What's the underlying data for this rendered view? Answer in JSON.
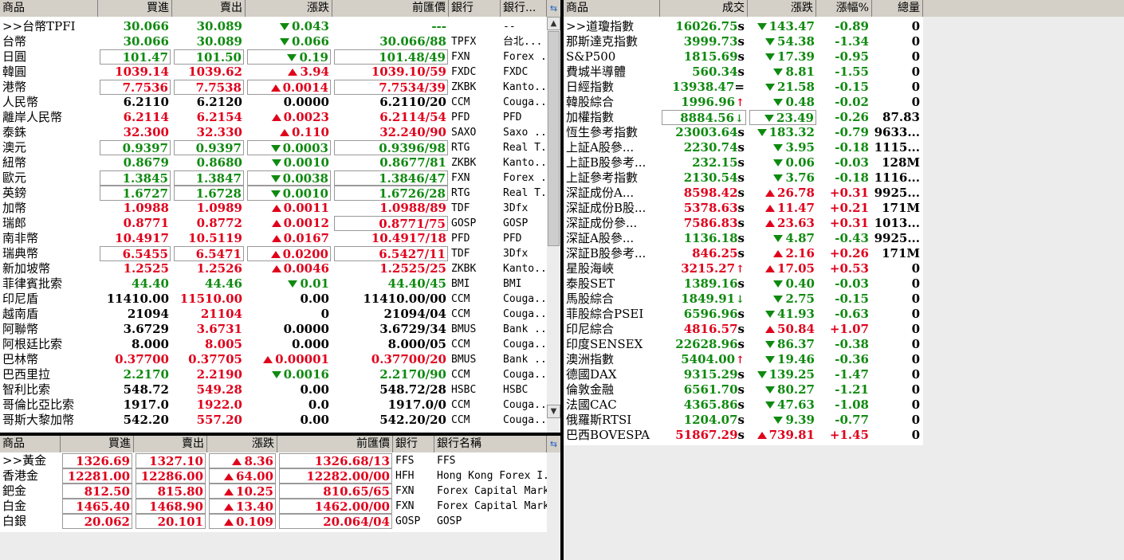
{
  "fx": {
    "headers": [
      "商品",
      "買進",
      "賣出",
      "漲跌",
      "前匯價",
      "銀行",
      "銀行..."
    ],
    "corner_icon": "refresh-icon",
    "rows": [
      {
        "name": ">>台幣TPFI",
        "bid": "30.066",
        "ask": "30.089",
        "chg": "0.043",
        "dir": "dn",
        "prev": "---",
        "bank": "",
        "bankname": "--"
      },
      {
        "name": "台幣",
        "bid": "30.066",
        "ask": "30.089",
        "chg": "0.066",
        "dir": "dn",
        "prev": "30.066/88",
        "bank": "TPFX",
        "bankname": "台北..."
      },
      {
        "name": "日圓",
        "bid": "101.47",
        "ask": "101.50",
        "chg": "0.19",
        "dir": "dn",
        "prev": "101.48/49",
        "bank": "FXN",
        "bankname": "Forex ...",
        "boxed": true
      },
      {
        "name": "韓圓",
        "bid": "1039.14",
        "ask": "1039.62",
        "chg": "3.94",
        "dir": "up",
        "prev": "1039.10/59",
        "bank": "FXDC",
        "bankname": "FXDC"
      },
      {
        "name": "港幣",
        "bid": "7.7536",
        "ask": "7.7538",
        "chg": "0.0014",
        "dir": "up",
        "prev": "7.7534/39",
        "bank": "ZKBK",
        "bankname": "Kanto...",
        "boxed": true
      },
      {
        "name": "人民幣",
        "bid": "6.2110",
        "ask": "6.2120",
        "chg": "0.0000",
        "dir": "fl",
        "prev": "6.2110/20",
        "bank": "CCM",
        "bankname": "Couga..."
      },
      {
        "name": "離岸人民幣",
        "bid": "6.2114",
        "ask": "6.2154",
        "chg": "0.0023",
        "dir": "up",
        "prev": "6.2114/54",
        "bank": "PFD",
        "bankname": "PFD"
      },
      {
        "name": "泰銖",
        "bid": "32.300",
        "ask": "32.330",
        "chg": "0.110",
        "dir": "up",
        "prev": "32.240/90",
        "bank": "SAXO",
        "bankname": "Saxo ..."
      },
      {
        "name": "澳元",
        "bid": "0.9397",
        "ask": "0.9397",
        "chg": "0.0003",
        "dir": "dn",
        "prev": "0.9396/98",
        "bank": "RTG",
        "bankname": "Real T...",
        "boxed": true
      },
      {
        "name": "紐幣",
        "bid": "0.8679",
        "ask": "0.8680",
        "chg": "0.0010",
        "dir": "dn",
        "prev": "0.8677/81",
        "bank": "ZKBK",
        "bankname": "Kanto..."
      },
      {
        "name": "歐元",
        "bid": "1.3845",
        "ask": "1.3847",
        "chg": "0.0038",
        "dir": "dn",
        "prev": "1.3846/47",
        "bank": "FXN",
        "bankname": "Forex ...",
        "boxed": true
      },
      {
        "name": "英鎊",
        "bid": "1.6727",
        "ask": "1.6728",
        "chg": "0.0010",
        "dir": "dn",
        "prev": "1.6726/28",
        "bank": "RTG",
        "bankname": "Real T...",
        "boxed": true
      },
      {
        "name": "加幣",
        "bid": "1.0988",
        "ask": "1.0989",
        "chg": "0.0011",
        "dir": "up",
        "prev": "1.0988/89",
        "bank": "TDF",
        "bankname": "3Dfx"
      },
      {
        "name": "瑞郎",
        "bid": "0.8771",
        "ask": "0.8772",
        "chg": "0.0012",
        "dir": "up",
        "prev": "0.8771/75",
        "bank": "GOSP",
        "bankname": "GOSP",
        "boxprev": true
      },
      {
        "name": "南非幣",
        "bid": "10.4917",
        "ask": "10.5119",
        "chg": "0.0167",
        "dir": "up",
        "prev": "10.4917/18",
        "bank": "PFD",
        "bankname": "PFD"
      },
      {
        "name": "瑞典幣",
        "bid": "6.5455",
        "ask": "6.5471",
        "chg": "0.0200",
        "dir": "up",
        "prev": "6.5427/11",
        "bank": "TDF",
        "bankname": "3Dfx",
        "boxed": true
      },
      {
        "name": "新加坡幣",
        "bid": "1.2525",
        "ask": "1.2526",
        "chg": "0.0046",
        "dir": "up",
        "prev": "1.2525/25",
        "bank": "ZKBK",
        "bankname": "Kanto..."
      },
      {
        "name": "菲律賓批索",
        "bid": "44.40",
        "ask": "44.46",
        "chg": "0.01",
        "dir": "dn",
        "prev": "44.40/45",
        "bank": "BMI",
        "bankname": "BMI"
      },
      {
        "name": "印尼盾",
        "bid": "11410.00",
        "ask": "11510.00",
        "chg": "0.00",
        "dir": "fl",
        "prev": "11410.00/00",
        "bank": "CCM",
        "bankname": "Couga...",
        "askup": true
      },
      {
        "name": "越南盾",
        "bid": "21094",
        "ask": "21104",
        "chg": "0",
        "dir": "fl",
        "prev": "21094/04",
        "bank": "CCM",
        "bankname": "Couga...",
        "askup": true
      },
      {
        "name": "阿聯幣",
        "bid": "3.6729",
        "ask": "3.6731",
        "chg": "0.0000",
        "dir": "fl",
        "prev": "3.6729/34",
        "bank": "BMUS",
        "bankname": "Bank ...",
        "askup": true
      },
      {
        "name": "阿根廷比索",
        "bid": "8.000",
        "ask": "8.005",
        "chg": "0.000",
        "dir": "fl",
        "prev": "8.000/05",
        "bank": "CCM",
        "bankname": "Couga...",
        "askup": true
      },
      {
        "name": "巴林幣",
        "bid": "0.37700",
        "ask": "0.37705",
        "chg": "0.00001",
        "dir": "up",
        "prev": "0.37700/20",
        "bank": "BMUS",
        "bankname": "Bank ..."
      },
      {
        "name": "巴西里拉",
        "bid": "2.2170",
        "ask": "2.2190",
        "chg": "0.0016",
        "dir": "dn",
        "prev": "2.2170/90",
        "bank": "CCM",
        "bankname": "Couga...",
        "askup": true
      },
      {
        "name": "智利比索",
        "bid": "548.72",
        "ask": "549.28",
        "chg": "0.00",
        "dir": "fl",
        "prev": "548.72/28",
        "bank": "HSBC",
        "bankname": "HSBC",
        "askup": true
      },
      {
        "name": "哥倫比亞比索",
        "bid": "1917.0",
        "ask": "1922.0",
        "chg": "0.0",
        "dir": "fl",
        "prev": "1917.0/0",
        "bank": "CCM",
        "bankname": "Couga...",
        "askup": true
      },
      {
        "name": "哥斯大黎加幣",
        "bid": "542.20",
        "ask": "557.20",
        "chg": "0.00",
        "dir": "fl",
        "prev": "542.20/20",
        "bank": "CCM",
        "bankname": "Couga...",
        "askup": true
      }
    ]
  },
  "metals": {
    "headers": [
      "商品",
      "買進",
      "賣出",
      "漲跌",
      "前匯價",
      "銀行",
      "銀行名稱"
    ],
    "corner_icon": "refresh-icon",
    "rows": [
      {
        "name": ">>黃金",
        "bid": "1326.69",
        "ask": "1327.10",
        "chg": "8.36",
        "prev": "1326.68/13",
        "bank": "FFS",
        "bankname": "FFS"
      },
      {
        "name": "香港金",
        "bid": "12281.00",
        "ask": "12286.00",
        "chg": "64.00",
        "prev": "12282.00/00",
        "bank": "HFH",
        "bankname": "Hong Kong Forex I..."
      },
      {
        "name": "鈀金",
        "bid": "812.50",
        "ask": "815.80",
        "chg": "10.25",
        "prev": "810.65/65",
        "bank": "FXN",
        "bankname": "Forex Capital Markets"
      },
      {
        "name": "白金",
        "bid": "1465.40",
        "ask": "1468.90",
        "chg": "13.40",
        "prev": "1462.00/00",
        "bank": "FXN",
        "bankname": "Forex Capital Markets"
      },
      {
        "name": "白銀",
        "bid": "20.062",
        "ask": "20.101",
        "chg": "0.109",
        "prev": "20.064/04",
        "bank": "GOSP",
        "bankname": "GOSP"
      }
    ]
  },
  "indices": {
    "headers": [
      "商品",
      "成交",
      "漲跌",
      "漲幅%",
      "總量"
    ],
    "rows": [
      {
        "name": ">>道瓊指數",
        "px": "16026.75",
        "mark": "s",
        "chg": "143.47",
        "dir": "dn",
        "pct": "-0.89",
        "vol": "0"
      },
      {
        "name": "那斯達克指數",
        "px": "3999.73",
        "mark": "s",
        "chg": "54.38",
        "dir": "dn",
        "pct": "-1.34",
        "vol": "0"
      },
      {
        "name": "S&P500",
        "px": "1815.69",
        "mark": "s",
        "chg": "17.39",
        "dir": "dn",
        "pct": "-0.95",
        "vol": "0"
      },
      {
        "name": "費城半導體",
        "px": "560.34",
        "mark": "s",
        "chg": "8.81",
        "dir": "dn",
        "pct": "-1.55",
        "vol": "0"
      },
      {
        "name": "日經指數",
        "px": "13938.47",
        "mark": "=",
        "chg": "21.58",
        "dir": "dn",
        "pct": "-0.15",
        "vol": "0"
      },
      {
        "name": "韓股綜合",
        "px": "1996.96",
        "mark": "↑",
        "chg": "0.48",
        "dir": "dn",
        "pct": "-0.02",
        "vol": "0"
      },
      {
        "name": "加權指數",
        "px": "8884.56",
        "mark": "↓",
        "chg": "23.49",
        "dir": "dn",
        "pct": "-0.26",
        "vol": "87.83",
        "boxed": true
      },
      {
        "name": "恆生參考指數",
        "px": "23003.64",
        "mark": "s",
        "chg": "183.32",
        "dir": "dn",
        "pct": "-0.79",
        "vol": "9633..."
      },
      {
        "name": "上証A股參...",
        "px": "2230.74",
        "mark": "s",
        "chg": "3.95",
        "dir": "dn",
        "pct": "-0.18",
        "vol": "1115..."
      },
      {
        "name": "上証B股參考...",
        "px": "232.15",
        "mark": "s",
        "chg": "0.06",
        "dir": "dn",
        "pct": "-0.03",
        "vol": "128M"
      },
      {
        "name": "上証參考指數",
        "px": "2130.54",
        "mark": "s",
        "chg": "3.76",
        "dir": "dn",
        "pct": "-0.18",
        "vol": "1116..."
      },
      {
        "name": "深証成份A...",
        "px": "8598.42",
        "mark": "s",
        "chg": "26.78",
        "dir": "up",
        "pct": "+0.31",
        "vol": "9925..."
      },
      {
        "name": "深証成份B股...",
        "px": "5378.63",
        "mark": "s",
        "chg": "11.47",
        "dir": "up",
        "pct": "+0.21",
        "vol": "171M"
      },
      {
        "name": "深証成份參...",
        "px": "7586.83",
        "mark": "s",
        "chg": "23.63",
        "dir": "up",
        "pct": "+0.31",
        "vol": "1013..."
      },
      {
        "name": "深証A股參...",
        "px": "1136.18",
        "mark": "s",
        "chg": "4.87",
        "dir": "dn",
        "pct": "-0.43",
        "vol": "9925..."
      },
      {
        "name": "深証B股參考...",
        "px": "846.25",
        "mark": "s",
        "chg": "2.16",
        "dir": "up",
        "pct": "+0.26",
        "vol": "171M"
      },
      {
        "name": "星股海峽",
        "px": "3215.27",
        "mark": "↑",
        "chg": "17.05",
        "dir": "up",
        "pct": "+0.53",
        "vol": "0"
      },
      {
        "name": "泰股SET",
        "px": "1389.16",
        "mark": "s",
        "chg": "0.40",
        "dir": "dn",
        "pct": "-0.03",
        "vol": "0"
      },
      {
        "name": "馬股綜合",
        "px": "1849.91",
        "mark": "↓",
        "chg": "2.75",
        "dir": "dn",
        "pct": "-0.15",
        "vol": "0"
      },
      {
        "name": "菲股綜合PSEI",
        "px": "6596.96",
        "mark": "s",
        "chg": "41.93",
        "dir": "dn",
        "pct": "-0.63",
        "vol": "0"
      },
      {
        "name": "印尼綜合",
        "px": "4816.57",
        "mark": "s",
        "chg": "50.84",
        "dir": "up",
        "pct": "+1.07",
        "vol": "0"
      },
      {
        "name": "印度SENSEX",
        "px": "22628.96",
        "mark": "s",
        "chg": "86.37",
        "dir": "dn",
        "pct": "-0.38",
        "vol": "0"
      },
      {
        "name": "澳洲指數",
        "px": "5404.00",
        "mark": "↑",
        "chg": "19.46",
        "dir": "dn",
        "pct": "-0.36",
        "vol": "0"
      },
      {
        "name": "德國DAX",
        "px": "9315.29",
        "mark": "s",
        "chg": "139.25",
        "dir": "dn",
        "pct": "-1.47",
        "vol": "0"
      },
      {
        "name": "倫敦金融",
        "px": "6561.70",
        "mark": "s",
        "chg": "80.27",
        "dir": "dn",
        "pct": "-1.21",
        "vol": "0"
      },
      {
        "name": "法國CAC",
        "px": "4365.86",
        "mark": "s",
        "chg": "47.63",
        "dir": "dn",
        "pct": "-1.08",
        "vol": "0"
      },
      {
        "name": "俄羅斯RTSI",
        "px": "1204.07",
        "mark": "s",
        "chg": "9.39",
        "dir": "dn",
        "pct": "-0.77",
        "vol": "0"
      },
      {
        "name": "巴西BOVESPA",
        "px": "51867.29",
        "mark": "s",
        "chg": "739.81",
        "dir": "up",
        "pct": "+1.45",
        "vol": "0"
      }
    ]
  }
}
